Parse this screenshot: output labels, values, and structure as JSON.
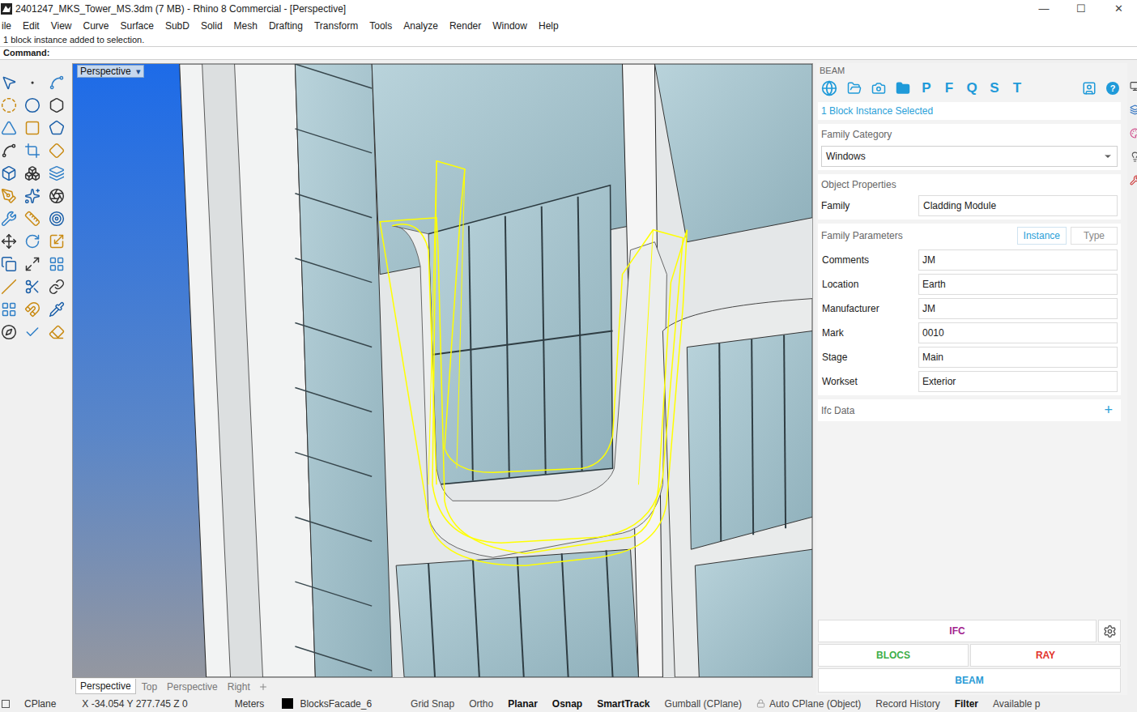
{
  "window": {
    "title": "2401247_MKS_Tower_MS.3dm (7 MB) - Rhino 8 Commercial - [Perspective]",
    "controls": [
      "—",
      "☐",
      "✕"
    ]
  },
  "menu": [
    "ile",
    "Edit",
    "View",
    "Curve",
    "Surface",
    "SubD",
    "Solid",
    "Mesh",
    "Drafting",
    "Transform",
    "Tools",
    "Analyze",
    "Render",
    "Window",
    "Help"
  ],
  "command_history": "1 block instance added to selection.",
  "command_prompt": "Command:",
  "viewport": {
    "label": "Perspective",
    "dropdown": "▾"
  },
  "viewport_tabs": [
    {
      "label": "Perspective",
      "selected": true
    },
    {
      "label": "Top",
      "selected": false
    },
    {
      "label": "Perspective",
      "selected": false
    },
    {
      "label": "Right",
      "selected": false
    }
  ],
  "beam_panel": {
    "title": "BEAM",
    "tool_letters": [
      "P",
      "F",
      "Q",
      "S",
      "T"
    ],
    "help": "?",
    "selection": "1 Block Instance Selected",
    "family_category": {
      "label": "Family Category",
      "value": "Windows"
    },
    "object_properties": {
      "label": "Object Properties",
      "family_label": "Family",
      "family_value": "Cladding Module"
    },
    "family_parameters": {
      "label": "Family Parameters",
      "tabs": [
        {
          "label": "Instance",
          "selected": true
        },
        {
          "label": "Type",
          "selected": false
        }
      ],
      "params": [
        {
          "label": "Comments",
          "value": "JM"
        },
        {
          "label": "Location",
          "value": "Earth"
        },
        {
          "label": "Manufacturer",
          "value": "JM"
        },
        {
          "label": "Mark",
          "value": "0010"
        },
        {
          "label": "Stage",
          "value": "Main"
        },
        {
          "label": "Workset",
          "value": "Exterior"
        }
      ]
    },
    "ifc_data": {
      "label": "Ifc Data",
      "add": "+"
    },
    "buttons": [
      {
        "label": "IFC",
        "color": "#a3238f"
      },
      {
        "label": "BLOCS",
        "color": "#3fae49"
      },
      {
        "label": "RAY",
        "color": "#e2332b"
      },
      {
        "label": "BEAM",
        "color": "#2a9bd6"
      }
    ]
  },
  "status_bar": {
    "cplane": "CPlane",
    "coords": "X -34.054 Y 277.745 Z 0",
    "units": "Meters",
    "layer": {
      "name": "BlocksFacade_6",
      "color": "#000000"
    },
    "toggles": [
      {
        "label": "Grid Snap",
        "on": false
      },
      {
        "label": "Ortho",
        "on": false
      },
      {
        "label": "Planar",
        "on": true
      },
      {
        "label": "Osnap",
        "on": true
      },
      {
        "label": "SmartTrack",
        "on": true
      },
      {
        "label": "Gumball (CPlane)",
        "on": false
      },
      {
        "label": "Auto CPlane (Object)",
        "on": false
      },
      {
        "label": "Record History",
        "on": false
      },
      {
        "label": "Filter",
        "on": true
      }
    ],
    "memory": "Available p"
  }
}
